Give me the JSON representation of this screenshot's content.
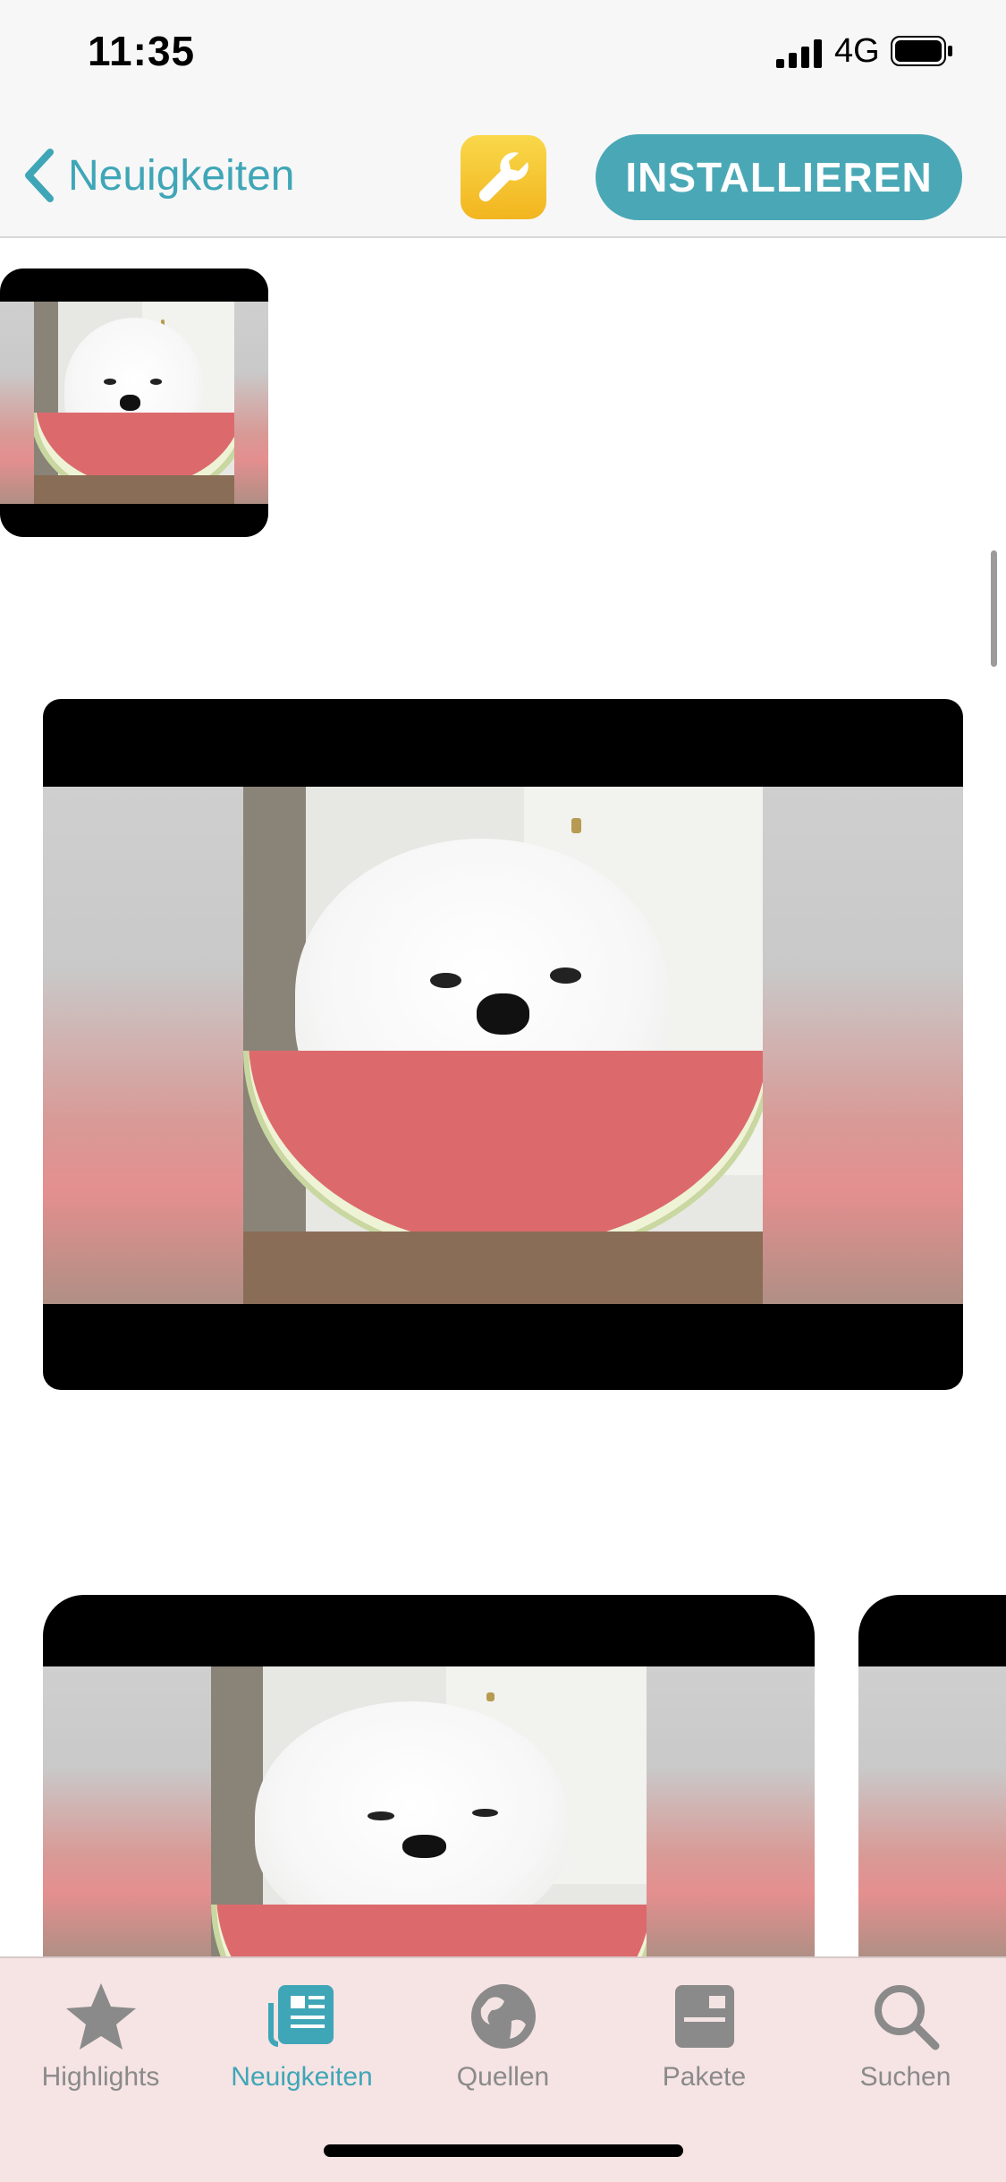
{
  "status_bar": {
    "time": "11:35",
    "network": "4G"
  },
  "nav": {
    "back_label": "Neuigkeiten",
    "app_icon": "wrench-icon",
    "install_label": "INSTALLIEREN"
  },
  "colors": {
    "accent": "#3fa6b7",
    "install_bg": "#4aa8b6",
    "app_icon_bg": "#f5c430"
  },
  "screenshots": [
    {
      "name": "screenshot-thumbnail-small"
    },
    {
      "name": "screenshot-large"
    },
    {
      "name": "screenshot-carousel-1"
    },
    {
      "name": "screenshot-carousel-2"
    }
  ],
  "tab_bar": {
    "tabs": [
      {
        "label": "Highlights",
        "icon": "star-icon",
        "active": false
      },
      {
        "label": "Neuigkeiten",
        "icon": "news-icon",
        "active": true
      },
      {
        "label": "Quellen",
        "icon": "globe-icon",
        "active": false
      },
      {
        "label": "Pakete",
        "icon": "package-icon",
        "active": false
      },
      {
        "label": "Suchen",
        "icon": "search-icon",
        "active": false
      }
    ]
  }
}
